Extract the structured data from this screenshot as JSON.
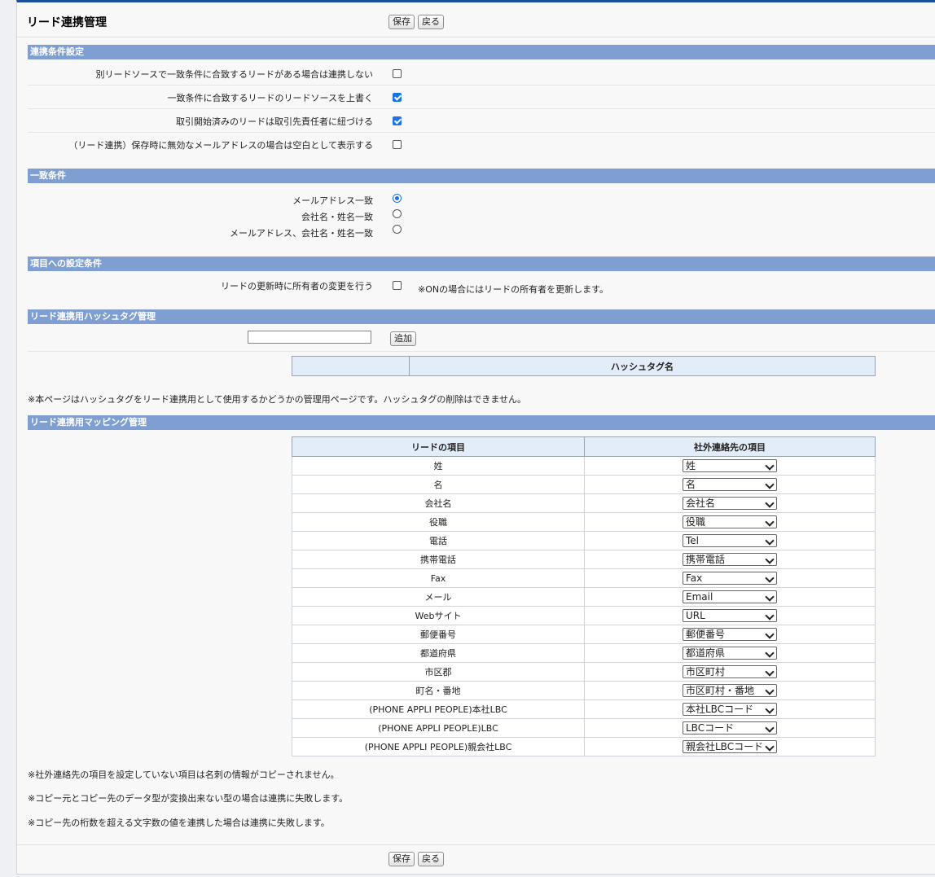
{
  "header": {
    "title": "リード連携管理",
    "save_label": "保存",
    "back_label": "戻る"
  },
  "sections": {
    "link_conditions": {
      "title": "連携条件設定",
      "rows": [
        {
          "label": "別リードソースで一致条件に合致するリードがある場合は連携しない",
          "checked": false
        },
        {
          "label": "一致条件に合致するリードのリードソースを上書く",
          "checked": true
        },
        {
          "label": "取引開始済みのリードは取引先責任者に紐づける",
          "checked": true
        },
        {
          "label": "（リード連携）保存時に無効なメールアドレスの場合は空白として表示する",
          "checked": false
        }
      ]
    },
    "match_conditions": {
      "title": "一致条件",
      "options": [
        {
          "label": "メールアドレス一致",
          "selected": true
        },
        {
          "label": "会社名・姓名一致",
          "selected": false
        },
        {
          "label": "メールアドレス、会社名・姓名一致",
          "selected": false
        }
      ]
    },
    "field_settings": {
      "title": "項目への設定条件",
      "label": "リードの更新時に所有者の変更を行う",
      "checked": false,
      "note": "※ONの場合にはリードの所有者を更新します。"
    },
    "hashtag": {
      "title": "リード連携用ハッシュタグ管理",
      "add_label": "追加",
      "input_value": "",
      "column": "ハッシュタグ名",
      "note": "※本ページはハッシュタグをリード連携用として使用するかどうかの管理用ページです。ハッシュタグの削除はできません。"
    },
    "mapping": {
      "title": "リード連携用マッピング管理",
      "col_lead": "リードの項目",
      "col_contact": "社外連絡先の項目",
      "rows": [
        {
          "lead": "姓",
          "contact": "姓"
        },
        {
          "lead": "名",
          "contact": "名"
        },
        {
          "lead": "会社名",
          "contact": "会社名"
        },
        {
          "lead": "役職",
          "contact": "役職"
        },
        {
          "lead": "電話",
          "contact": "Tel"
        },
        {
          "lead": "携帯電話",
          "contact": "携帯電話"
        },
        {
          "lead": "Fax",
          "contact": "Fax"
        },
        {
          "lead": "メール",
          "contact": "Email"
        },
        {
          "lead": "Webサイト",
          "contact": "URL"
        },
        {
          "lead": "郵便番号",
          "contact": "郵便番号"
        },
        {
          "lead": "都道府県",
          "contact": "都道府県"
        },
        {
          "lead": "市区郡",
          "contact": "市区町村"
        },
        {
          "lead": "町名・番地",
          "contact": "市区町村・番地"
        },
        {
          "lead": "(PHONE APPLI PEOPLE)本社LBC",
          "contact": "本社LBCコード"
        },
        {
          "lead": "(PHONE APPLI PEOPLE)LBC",
          "contact": "LBCコード"
        },
        {
          "lead": "(PHONE APPLI PEOPLE)親会社LBC",
          "contact": "親会社LBCコード"
        }
      ],
      "notes": [
        "※社外連絡先の項目を設定していない項目は名刺の情報がコピーされません。",
        "※コピー元とコピー先のデータ型が変換出来ない型の場合は連携に失敗します。",
        "※コピー先の桁数を超える文字数の値を連携した場合は連携に失敗します。"
      ]
    }
  },
  "footer": {
    "save_label": "保存",
    "back_label": "戻る"
  }
}
